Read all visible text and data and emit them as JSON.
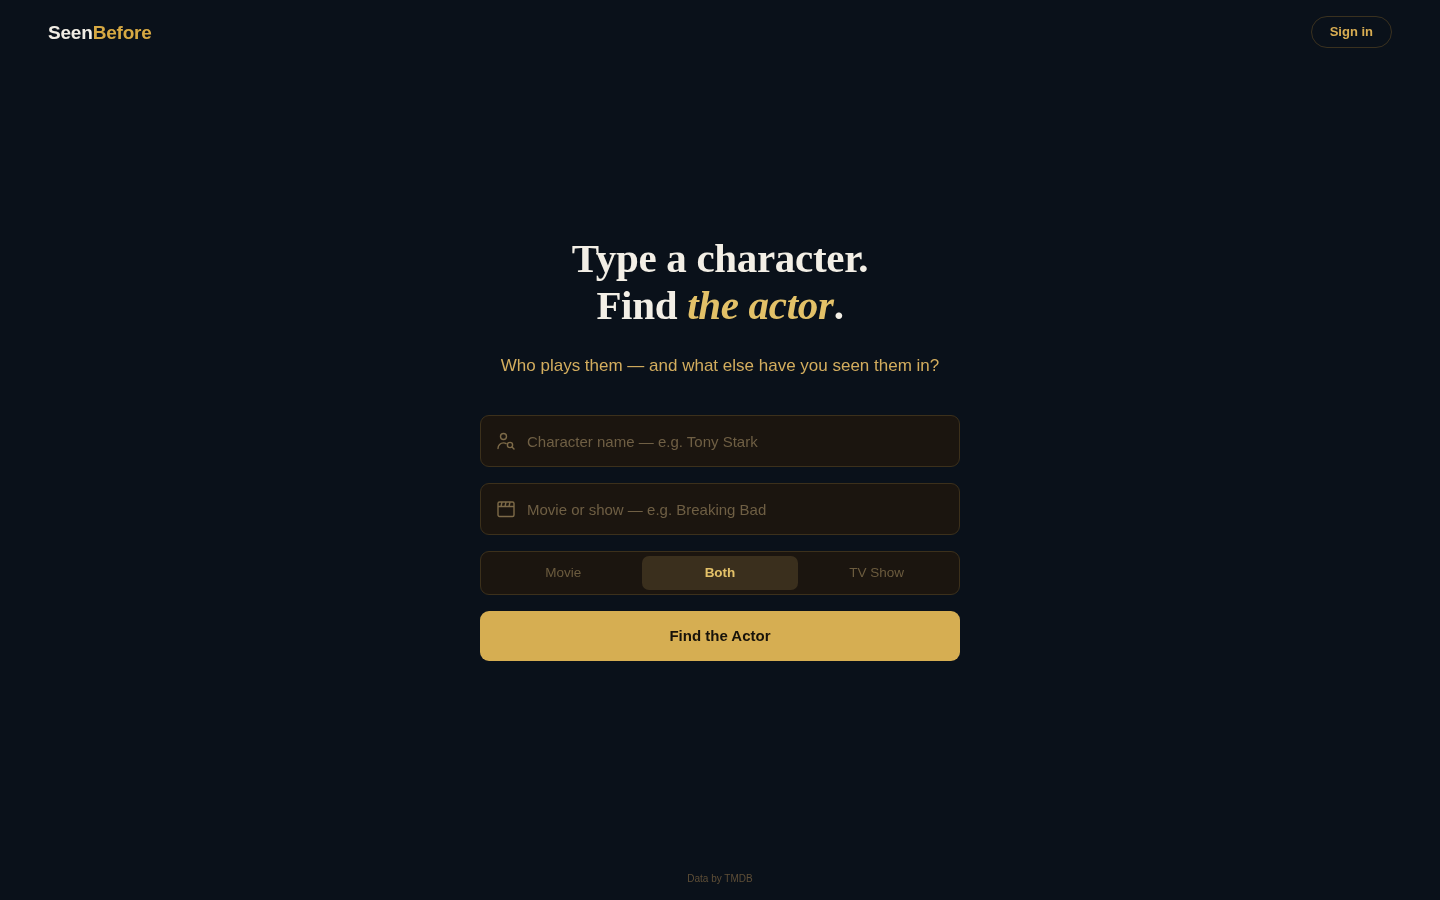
{
  "header": {
    "logo": {
      "first": "Seen",
      "second": "Before"
    },
    "sign_in": "Sign in"
  },
  "hero": {
    "headline": [
      "Type a character.",
      "Find *the actor*."
    ],
    "subtitle": "Who plays them — and what else have you seen them in?"
  },
  "search": {
    "fields": [
      {
        "kind": "character",
        "placeholder": "Character name — e.g. Tony Stark"
      },
      {
        "kind": "title",
        "placeholder": "Movie or show — e.g. Breaking Bad"
      }
    ],
    "media_types": [
      {
        "label": "Movie",
        "selected": false
      },
      {
        "label": "Both",
        "selected": true
      },
      {
        "label": "TV Show",
        "selected": false
      }
    ],
    "submit": "Find the Actor"
  },
  "footer": {
    "credit": "Data by TMDB"
  }
}
